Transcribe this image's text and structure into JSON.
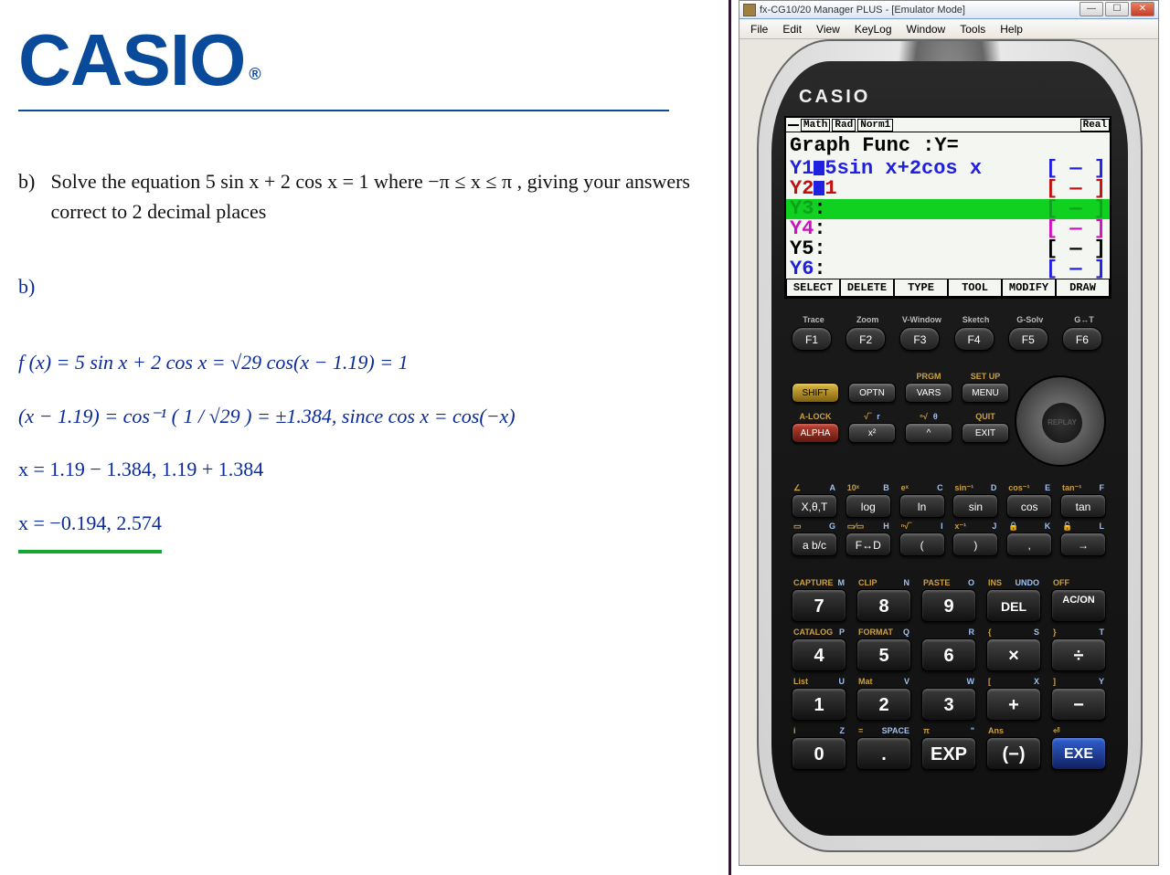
{
  "doc": {
    "logo": "CASIO",
    "logo_r": "®",
    "question_label": "b)",
    "question_p1": "Solve the equation  5 sin x + 2 cos x = 1 where  −π ≤ x ≤ π   , giving your answers correct to 2 decimal places",
    "ans_label": "b)",
    "eq1": "f (x) = 5 sin x + 2 cos x = √29 cos(x − 1.19) = 1",
    "eq2": "(x − 1.19) = cos⁻¹ ( 1 / √29 ) = ±1.384,  since  cos x = cos(−x)",
    "eq3": "x = 1.19 − 1.384, 1.19 + 1.384",
    "eq4": "x = −0.194, 2.574"
  },
  "win": {
    "title": "fx-CG10/20 Manager PLUS - [Emulator Mode]",
    "min": "—",
    "max": "☐",
    "close": "✕",
    "menu": [
      "File",
      "Edit",
      "View",
      "KeyLog",
      "Window",
      "Tools",
      "Help"
    ]
  },
  "calc": {
    "brand": "CASIO",
    "status": [
      "Math",
      "Rad",
      "Norm1"
    ],
    "status_real": "Real",
    "title": "Graph Func   :Y=",
    "y": [
      {
        "lab": "Y1",
        "eq": "5sin x+2cos x",
        "br": "[ — ]"
      },
      {
        "lab": "Y2",
        "eq": "1",
        "br": "[ — ]"
      },
      {
        "lab": "Y3",
        "eq": ":",
        "br": "[ — ]"
      },
      {
        "lab": "Y4",
        "eq": ":",
        "br": "[ — ]"
      },
      {
        "lab": "Y5",
        "eq": ":",
        "br": "[ — ]"
      },
      {
        "lab": "Y6",
        "eq": ":",
        "br": "[ — ]"
      }
    ],
    "soft": [
      "SELECT",
      "DELETE",
      "TYPE",
      "TOOL",
      "MODIFY",
      "DRAW"
    ],
    "f_labels": [
      "Trace",
      "Zoom",
      "V-Window",
      "Sketch",
      "G-Solv",
      "G↔T"
    ],
    "f_keys": [
      "F1",
      "F2",
      "F3",
      "F4",
      "F5",
      "F6"
    ],
    "shift": "SHIFT",
    "alock": "A-LOCK",
    "alpha": "ALPHA",
    "optn": "OPTN",
    "vars": "VARS",
    "sqrt": "√‾",
    "x2": "x²",
    "carat": "^",
    "prgm": "PRGM",
    "menu": "MENU",
    "setup": "SET UP",
    "quit": "QUIT",
    "exit": "EXIT",
    "replay": "REPLAY",
    "sci_rows": [
      [
        {
          "l": "∠",
          "r": "A",
          "k": "X,θ,T"
        },
        {
          "l": "10ˣ",
          "r": "B",
          "k": "log"
        },
        {
          "l": "eˣ",
          "r": "C",
          "k": "ln"
        },
        {
          "l": "sin⁻¹",
          "r": "D",
          "k": "sin"
        },
        {
          "l": "cos⁻¹",
          "r": "E",
          "k": "cos"
        },
        {
          "l": "tan⁻¹",
          "r": "F",
          "k": "tan"
        }
      ],
      [
        {
          "l": "▭",
          "r": "G",
          "k": "a b/c"
        },
        {
          "l": "▭⁄▭",
          "r": "H",
          "k": "F↔D"
        },
        {
          "l": "ⁿ√‾",
          "r": "I",
          "k": "("
        },
        {
          "l": "x⁻¹",
          "r": "J",
          "k": ")"
        },
        {
          "l": "🔒",
          "r": "K",
          "k": ","
        },
        {
          "l": "🔓",
          "r": "L",
          "k": "→"
        }
      ]
    ],
    "num_rows": [
      [
        {
          "l": "CAPTURE",
          "r": "M",
          "k": "7"
        },
        {
          "l": "CLIP",
          "r": "N",
          "k": "8"
        },
        {
          "l": "PASTE",
          "r": "O",
          "k": "9"
        },
        {
          "l": "INS",
          "r": "UNDO",
          "k": "DEL",
          "cls": "del"
        },
        {
          "l": "OFF",
          "r": "",
          "k": "AC/ON",
          "cls": "acon"
        }
      ],
      [
        {
          "l": "CATALOG",
          "r": "P",
          "k": "4"
        },
        {
          "l": "FORMAT",
          "r": "Q",
          "k": "5"
        },
        {
          "l": "",
          "r": "R",
          "k": "6"
        },
        {
          "l": "{",
          "r": "S",
          "k": "×",
          "cls": "op"
        },
        {
          "l": "}",
          "r": "T",
          "k": "÷",
          "cls": "op"
        }
      ],
      [
        {
          "l": "List",
          "r": "U",
          "k": "1"
        },
        {
          "l": "Mat",
          "r": "V",
          "k": "2"
        },
        {
          "l": "",
          "r": "W",
          "k": "3"
        },
        {
          "l": "[",
          "r": "X",
          "k": "+",
          "cls": "op"
        },
        {
          "l": "]",
          "r": "Y",
          "k": "−",
          "cls": "op"
        }
      ],
      [
        {
          "l": "i",
          "r": "Z",
          "k": "0"
        },
        {
          "l": "=",
          "r": "SPACE",
          "k": "."
        },
        {
          "l": "π",
          "r": "\"",
          "k": "EXP"
        },
        {
          "l": "Ans",
          "r": "",
          "k": "(−)"
        },
        {
          "l": "⏎",
          "r": "",
          "k": "EXE",
          "cls": "exe"
        }
      ]
    ]
  }
}
